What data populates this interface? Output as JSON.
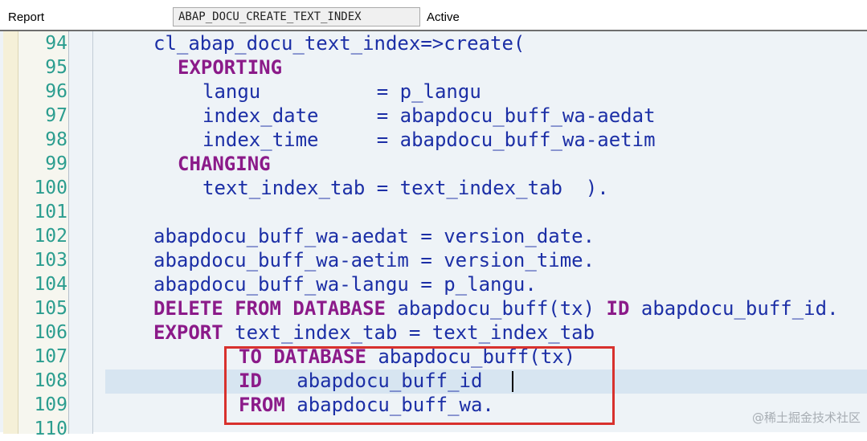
{
  "header": {
    "type_label": "Report",
    "program_name": "ABAP_DOCU_CREATE_TEXT_INDEX",
    "status": "Active"
  },
  "editor": {
    "lines": [
      {
        "num": "94",
        "segments": [
          {
            "t": "cl_abap_docu_text_index=>create(",
            "k": false
          }
        ]
      },
      {
        "num": "95",
        "segments": [
          {
            "t": "EXPORTING",
            "k": true
          }
        ]
      },
      {
        "num": "96",
        "segments": [
          {
            "t": "langu          = p_langu",
            "k": false
          }
        ]
      },
      {
        "num": "97",
        "segments": [
          {
            "t": "index_date     = abapdocu_buff_wa-aedat",
            "k": false
          }
        ]
      },
      {
        "num": "98",
        "segments": [
          {
            "t": "index_time     = abapdocu_buff_wa-aetim",
            "k": false
          }
        ]
      },
      {
        "num": "99",
        "segments": [
          {
            "t": "CHANGING",
            "k": true
          }
        ]
      },
      {
        "num": "100",
        "segments": [
          {
            "t": "text_index_tab = text_index_tab  ).",
            "k": false
          }
        ]
      },
      {
        "num": "101",
        "segments": []
      },
      {
        "num": "102",
        "segments": [
          {
            "t": "abapdocu_buff_wa-aedat = version_date.",
            "k": false
          }
        ]
      },
      {
        "num": "103",
        "segments": [
          {
            "t": "abapdocu_buff_wa-aetim = version_time.",
            "k": false
          }
        ]
      },
      {
        "num": "104",
        "segments": [
          {
            "t": "abapdocu_buff_wa-langu = p_langu.",
            "k": false
          }
        ]
      },
      {
        "num": "105",
        "segments": [
          {
            "t": "DELETE FROM DATABASE",
            "k": true
          },
          {
            "t": " abapdocu_buff(tx) ",
            "k": false
          },
          {
            "t": "ID",
            "k": true
          },
          {
            "t": " abapdocu_buff_id.",
            "k": false
          }
        ]
      },
      {
        "num": "106",
        "segments": [
          {
            "t": "EXPORT",
            "k": true
          },
          {
            "t": " text_index_tab = text_index_tab",
            "k": false
          }
        ]
      },
      {
        "num": "107",
        "segments": [
          {
            "t": "TO DATABASE",
            "k": true
          },
          {
            "t": " abapdocu_buff(tx)",
            "k": false
          }
        ]
      },
      {
        "num": "108",
        "segments": [
          {
            "t": "ID",
            "k": true
          },
          {
            "t": "   abapdocu_buff_id",
            "k": false
          }
        ]
      },
      {
        "num": "109",
        "segments": [
          {
            "t": "FROM",
            "k": true
          },
          {
            "t": " abapdocu_buff_wa.",
            "k": false
          }
        ]
      },
      {
        "num": "110",
        "segments": []
      }
    ]
  },
  "watermark": "@稀土掘金技术社区",
  "colors": {
    "keyword": "#8b1a89",
    "identifier": "#1c2fa6",
    "line_number": "#2b9d8f",
    "highlight_box": "#d8312d",
    "current_line": "#d7e5f1"
  }
}
